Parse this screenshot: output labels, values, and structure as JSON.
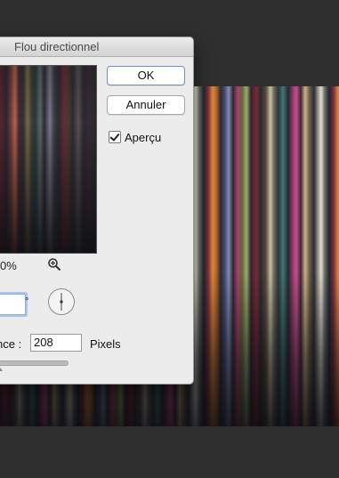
{
  "dialog": {
    "title": "Flou directionnel",
    "ok_label": "OK",
    "cancel_label": "Annuler",
    "preview_checkbox": {
      "label": "Aperçu",
      "checked": true
    },
    "zoom_text": "0%",
    "angle": {
      "value": "",
      "unit": "°"
    },
    "distance": {
      "label": "nce :",
      "value": "208",
      "unit": "Pixels"
    }
  },
  "icons": [
    "zoom-in-icon",
    "angle-dial-icon",
    "slider-thumb-icon"
  ],
  "colors": {
    "dialog_bg": "#ececec",
    "canvas_bg": "#2f2f2f",
    "focus_ring": "#a9c5f0"
  }
}
